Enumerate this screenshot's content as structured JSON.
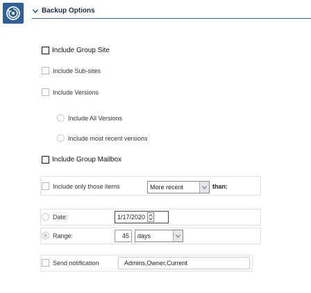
{
  "header": {
    "title": "Backup Options",
    "chevron_icon": "chevron-down-icon",
    "app_icon": "backup-app-icon",
    "accent_color": "#2f5f9a"
  },
  "options": {
    "include_group_site": "Include Group Site",
    "include_sub_sites": "Include Sub-sites",
    "include_versions": "Include Versions",
    "include_all_versions": "Include All Versions",
    "include_most_recent_versions": "Include most recent versions",
    "include_group_mailbox": "Include Group Mailbox"
  },
  "filter": {
    "label": "Include only those items",
    "selected": "More recent",
    "suffix": "than:"
  },
  "date": {
    "label": "Date:",
    "value": "1/17/2020"
  },
  "range": {
    "label": "Range:",
    "value": "45",
    "unit": "days"
  },
  "notification": {
    "label": "Send notification",
    "value": "Admins,Owner,Current"
  }
}
